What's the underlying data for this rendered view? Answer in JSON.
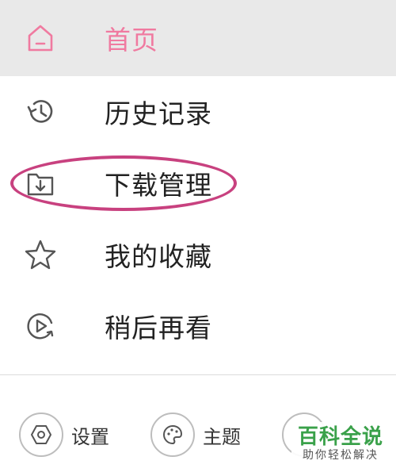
{
  "menu": {
    "items": [
      {
        "label": "首页",
        "icon": "home-icon",
        "active": true
      },
      {
        "label": "历史记录",
        "icon": "history-icon",
        "active": false
      },
      {
        "label": "下载管理",
        "icon": "download-folder-icon",
        "active": false
      },
      {
        "label": "我的收藏",
        "icon": "star-icon",
        "active": false
      },
      {
        "label": "稍后再看",
        "icon": "watch-later-icon",
        "active": false
      }
    ]
  },
  "bottom": {
    "settings_label": "设置",
    "theme_label": "主题"
  },
  "watermark": {
    "main": "百科全说",
    "sub": "助你轻松解决"
  },
  "colors": {
    "accent": "#f07aa0",
    "highlight": "#c8417f",
    "active_bg": "#e9e9e9",
    "watermark_green": "#3aa14a"
  }
}
